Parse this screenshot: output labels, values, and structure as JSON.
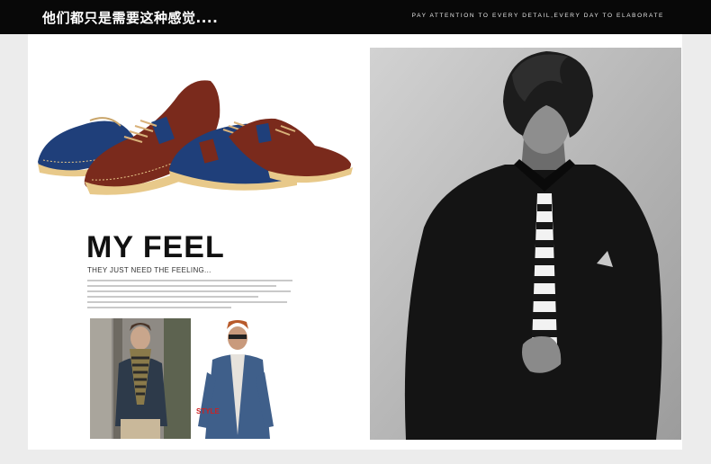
{
  "header": {
    "title": "他们都只是需要这种感觉....",
    "tagline": "PAY ATTENTION TO EVERY DETAIL,EVERY DAY TO ELABORATE"
  },
  "feature": {
    "headline": "MY FEEL",
    "subheadline": "THEY JUST NEED THE FEELING...",
    "inset_caption": "STYLE"
  },
  "colors": {
    "topbar": "#080808",
    "page_background": "#ececec",
    "canvas": "#ffffff",
    "shoe_blue": "#1f3f7a",
    "shoe_brown": "#7a2a1c",
    "sole": "#e8c98a"
  },
  "images": {
    "shoes": "shoe-product-image",
    "inset_left": "model-striped-scarf",
    "inset_right": "model-denim-jacket",
    "main": "model-black-suit-striped-tie"
  }
}
